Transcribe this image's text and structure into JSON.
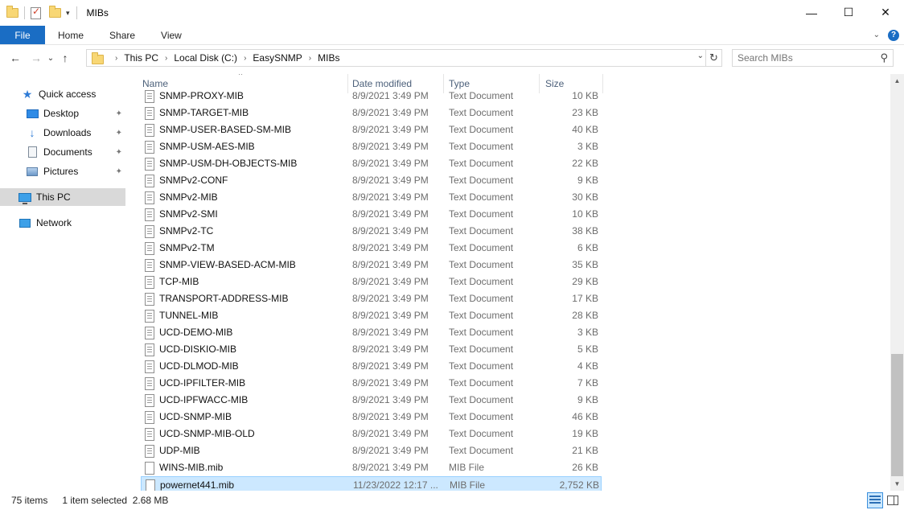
{
  "window": {
    "title": "MIBs",
    "controls": {
      "minimize": "—",
      "maximize": "☐",
      "close": "✕"
    }
  },
  "ribbon": {
    "tabs": [
      {
        "label": "File",
        "active": true
      },
      {
        "label": "Home"
      },
      {
        "label": "Share"
      },
      {
        "label": "View"
      }
    ],
    "help": "?"
  },
  "nav": {
    "back": "←",
    "forward": "→",
    "recent": "⌄",
    "up": "↑",
    "breadcrumb": [
      "This PC",
      "Local Disk (C:)",
      "EasySNMP",
      "MIBs"
    ],
    "search_placeholder": "Search MIBs"
  },
  "sidebar": {
    "items": [
      {
        "label": "Quick access",
        "icon": "star-icon"
      },
      {
        "label": "Desktop",
        "icon": "desktop-icon",
        "pinned": true
      },
      {
        "label": "Downloads",
        "icon": "download-icon",
        "pinned": true
      },
      {
        "label": "Documents",
        "icon": "documents-icon",
        "pinned": true
      },
      {
        "label": "Pictures",
        "icon": "pictures-icon",
        "pinned": true
      },
      {
        "label": "This PC",
        "icon": "computer-icon",
        "selected": true
      },
      {
        "label": "Network",
        "icon": "network-icon"
      }
    ],
    "pin_glyph": "📌"
  },
  "columns": {
    "name": "Name",
    "date": "Date modified",
    "type": "Type",
    "size": "Size"
  },
  "files": [
    {
      "name": "SNMP-PROXY-MIB",
      "date": "8/9/2021 3:49 PM",
      "type": "Text Document",
      "size": "10 KB",
      "kind": "txt"
    },
    {
      "name": "SNMP-TARGET-MIB",
      "date": "8/9/2021 3:49 PM",
      "type": "Text Document",
      "size": "23 KB",
      "kind": "txt"
    },
    {
      "name": "SNMP-USER-BASED-SM-MIB",
      "date": "8/9/2021 3:49 PM",
      "type": "Text Document",
      "size": "40 KB",
      "kind": "txt"
    },
    {
      "name": "SNMP-USM-AES-MIB",
      "date": "8/9/2021 3:49 PM",
      "type": "Text Document",
      "size": "3 KB",
      "kind": "txt"
    },
    {
      "name": "SNMP-USM-DH-OBJECTS-MIB",
      "date": "8/9/2021 3:49 PM",
      "type": "Text Document",
      "size": "22 KB",
      "kind": "txt"
    },
    {
      "name": "SNMPv2-CONF",
      "date": "8/9/2021 3:49 PM",
      "type": "Text Document",
      "size": "9 KB",
      "kind": "txt"
    },
    {
      "name": "SNMPv2-MIB",
      "date": "8/9/2021 3:49 PM",
      "type": "Text Document",
      "size": "30 KB",
      "kind": "txt"
    },
    {
      "name": "SNMPv2-SMI",
      "date": "8/9/2021 3:49 PM",
      "type": "Text Document",
      "size": "10 KB",
      "kind": "txt"
    },
    {
      "name": "SNMPv2-TC",
      "date": "8/9/2021 3:49 PM",
      "type": "Text Document",
      "size": "38 KB",
      "kind": "txt"
    },
    {
      "name": "SNMPv2-TM",
      "date": "8/9/2021 3:49 PM",
      "type": "Text Document",
      "size": "6 KB",
      "kind": "txt"
    },
    {
      "name": "SNMP-VIEW-BASED-ACM-MIB",
      "date": "8/9/2021 3:49 PM",
      "type": "Text Document",
      "size": "35 KB",
      "kind": "txt"
    },
    {
      "name": "TCP-MIB",
      "date": "8/9/2021 3:49 PM",
      "type": "Text Document",
      "size": "29 KB",
      "kind": "txt"
    },
    {
      "name": "TRANSPORT-ADDRESS-MIB",
      "date": "8/9/2021 3:49 PM",
      "type": "Text Document",
      "size": "17 KB",
      "kind": "txt"
    },
    {
      "name": "TUNNEL-MIB",
      "date": "8/9/2021 3:49 PM",
      "type": "Text Document",
      "size": "28 KB",
      "kind": "txt"
    },
    {
      "name": "UCD-DEMO-MIB",
      "date": "8/9/2021 3:49 PM",
      "type": "Text Document",
      "size": "3 KB",
      "kind": "txt"
    },
    {
      "name": "UCD-DISKIO-MIB",
      "date": "8/9/2021 3:49 PM",
      "type": "Text Document",
      "size": "5 KB",
      "kind": "txt"
    },
    {
      "name": "UCD-DLMOD-MIB",
      "date": "8/9/2021 3:49 PM",
      "type": "Text Document",
      "size": "4 KB",
      "kind": "txt"
    },
    {
      "name": "UCD-IPFILTER-MIB",
      "date": "8/9/2021 3:49 PM",
      "type": "Text Document",
      "size": "7 KB",
      "kind": "txt"
    },
    {
      "name": "UCD-IPFWACC-MIB",
      "date": "8/9/2021 3:49 PM",
      "type": "Text Document",
      "size": "9 KB",
      "kind": "txt"
    },
    {
      "name": "UCD-SNMP-MIB",
      "date": "8/9/2021 3:49 PM",
      "type": "Text Document",
      "size": "46 KB",
      "kind": "txt"
    },
    {
      "name": "UCD-SNMP-MIB-OLD",
      "date": "8/9/2021 3:49 PM",
      "type": "Text Document",
      "size": "19 KB",
      "kind": "txt"
    },
    {
      "name": "UDP-MIB",
      "date": "8/9/2021 3:49 PM",
      "type": "Text Document",
      "size": "21 KB",
      "kind": "txt"
    },
    {
      "name": "WINS-MIB.mib",
      "date": "8/9/2021 3:49 PM",
      "type": "MIB File",
      "size": "26 KB",
      "kind": "blank"
    },
    {
      "name": "powernet441.mib",
      "date": "11/23/2022 12:17 ...",
      "type": "MIB File",
      "size": "2,752 KB",
      "kind": "blank",
      "selected": true
    }
  ],
  "status": {
    "count": "75 items",
    "selection": "1 item selected  2.68 MB"
  },
  "colors": {
    "accent": "#1a6dc4",
    "selection": "#cce8ff",
    "selection_border": "#99d1ff",
    "sidebar_selected": "#d9d9d9"
  }
}
